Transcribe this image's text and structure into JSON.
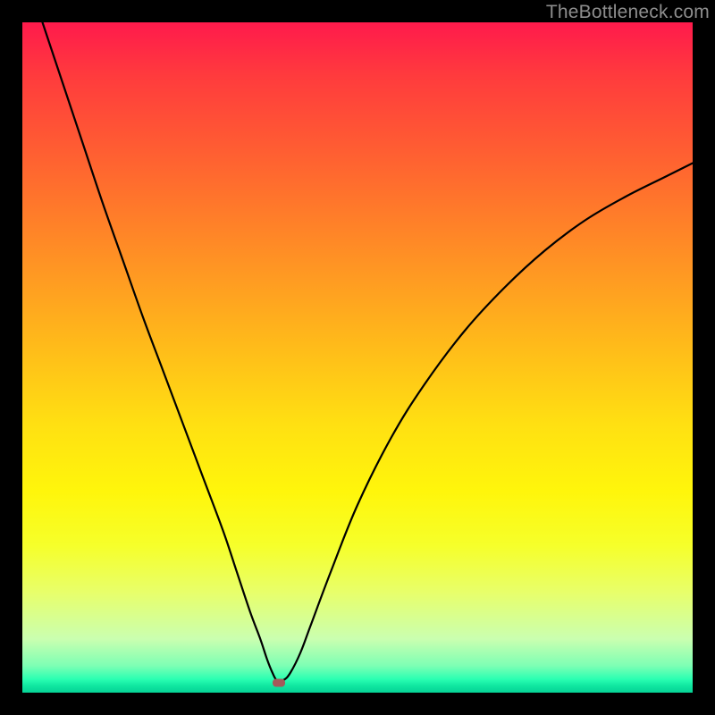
{
  "watermark": "TheBottleneck.com",
  "colors": {
    "curve": "#000000",
    "marker": "#a45a5a",
    "frame": "#000000"
  },
  "chart_data": {
    "type": "line",
    "title": "",
    "xlabel": "",
    "ylabel": "",
    "xlim": [
      0,
      100
    ],
    "ylim": [
      0,
      100
    ],
    "marker": {
      "x": 38.2,
      "y": 1.5
    },
    "series": [
      {
        "name": "bottleneck-curve",
        "x": [
          3,
          6,
          9,
          12,
          15,
          18,
          21,
          24,
          27,
          30,
          32,
          34,
          35.5,
          36.5,
          37.3,
          38,
          39,
          40,
          41.5,
          43,
          46,
          50,
          55,
          60,
          66,
          72,
          78,
          84,
          90,
          96,
          100
        ],
        "y": [
          100,
          91,
          82,
          73,
          64.5,
          56,
          48,
          40,
          32,
          24,
          18,
          12,
          8,
          5,
          3,
          1.8,
          1.9,
          3,
          6,
          10,
          18,
          28,
          38,
          46,
          54,
          60.5,
          66,
          70.5,
          74,
          77,
          79
        ]
      }
    ]
  }
}
